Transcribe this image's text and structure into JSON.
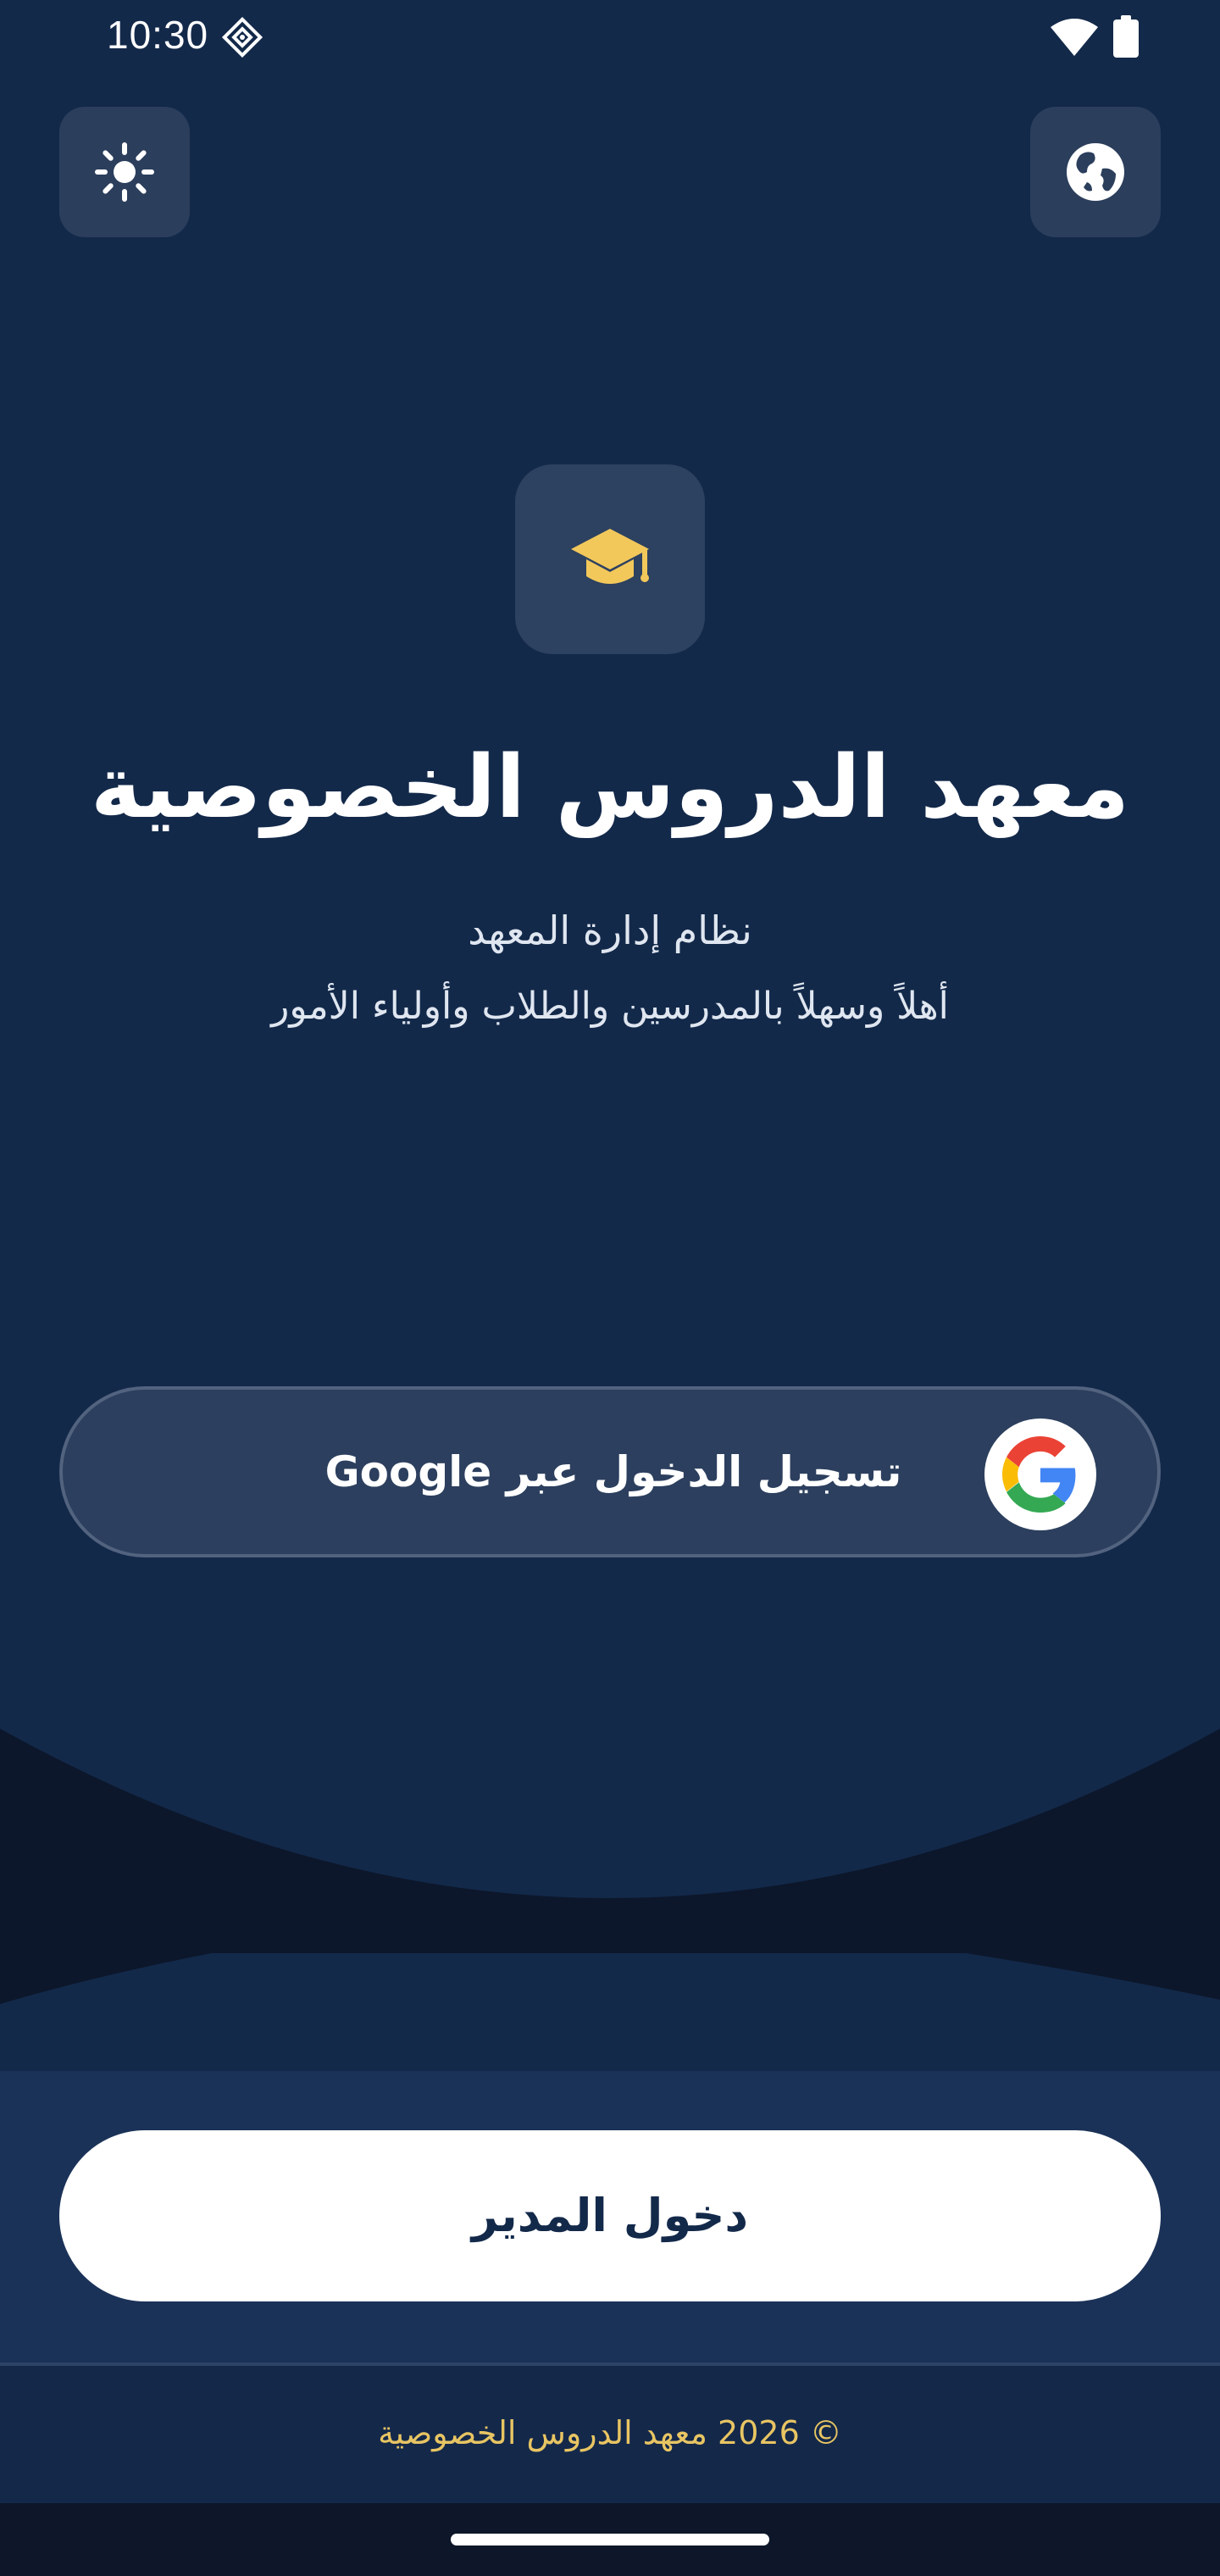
{
  "status_bar": {
    "time": "10:30",
    "dev_icon": "developer-mode-icon",
    "wifi_icon": "wifi-icon",
    "battery_icon": "battery-icon"
  },
  "header": {
    "theme_toggle_icon": "sun-icon",
    "language_icon": "globe-icon"
  },
  "hero": {
    "logo_icon": "graduation-cap-icon",
    "title": "معهد الدروس الخصوصية",
    "subtitle": "نظام إدارة المعهد",
    "welcome": "أهلاً وسهلاً بالمدرسين والطلاب وأولياء الأمور"
  },
  "google_signin": {
    "label": "تسجيل الدخول عبر Google",
    "icon": "google-icon"
  },
  "admin": {
    "label": "دخول المدير"
  },
  "footer": {
    "copyright": "© 2026 معهد الدروس الخصوصية"
  },
  "colors": {
    "background": "#13294a",
    "accent": "#f2c85b",
    "footer_text": "#e8c563",
    "button_surface": "#2c3f5e",
    "admin_button": "#ffffff"
  }
}
